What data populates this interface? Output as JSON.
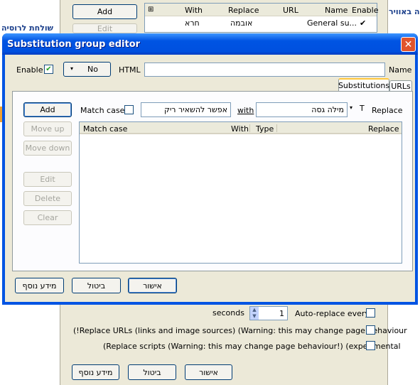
{
  "background": {
    "right_edge_text": "ה באוויר",
    "left_edge_text": "שולחת לרוסיה",
    "add_button": "Add",
    "edit_button": "Edit",
    "group_table": {
      "headers": [
        "With",
        "Replace",
        "URL",
        "Name",
        "Enable"
      ],
      "row": {
        "with": "חרא",
        "replace": "אובמה",
        "url": "",
        "name": "General su...",
        "enable": "✔"
      }
    },
    "seconds_label": "seconds",
    "seconds_value": "1",
    "auto_replace_label": "Auto-replace every",
    "replace_urls_label": "(!Replace URLs (links and image sources) (Warning: this may change page behaviour",
    "replace_scripts_label": "(Replace scripts (Warning: this may change page behaviour!) (experimental",
    "ok_button": "אישור",
    "cancel_button": "ביטול",
    "more_info_button": "מידע נוסף"
  },
  "dialog": {
    "title": "Substitution group editor",
    "enable_label": "Enable",
    "enable_checked": "✔",
    "no_button_arrow": "▾",
    "no_button": "No",
    "html_label": "HTML",
    "name_value": "",
    "name_label": "Name",
    "tabs": [
      "Substitutions",
      "URLs"
    ],
    "add_button": "Add",
    "move_up_button": "Move up",
    "move_down_button": "Move down",
    "edit_button": "Edit",
    "delete_button": "Delete",
    "clear_button": "Clear",
    "match_case_label": "Match case",
    "with_value": "אפשר להשאיר ריק",
    "with_label": "with",
    "replace_value": "מילה גסה",
    "type_arrow": "▾",
    "type_value": "T",
    "replace_label": "Replace",
    "table_headers": [
      "Match case",
      "With",
      "Type",
      "Replace"
    ],
    "ok_button": "אישור",
    "cancel_button": "ביטול",
    "more_info_button": "מידע נוסף"
  },
  "colors": {
    "titlebar": "#0054e3",
    "dialog_bg": "#ece9d8",
    "close_button": "#e1542c",
    "tab_highlight": "#ffc83c"
  }
}
